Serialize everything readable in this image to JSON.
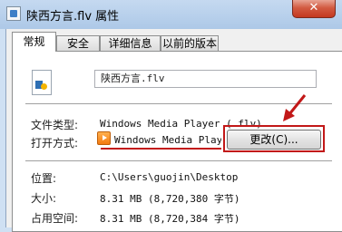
{
  "window": {
    "title": "陕西方言.flv 属性",
    "close_label": "✕"
  },
  "tabs": [
    {
      "label": "常规",
      "active": true
    },
    {
      "label": "安全",
      "active": false
    },
    {
      "label": "详细信息",
      "active": false
    },
    {
      "label": "以前的版本",
      "active": false
    }
  ],
  "general": {
    "filename": "陕西方言.flv",
    "file_type_label": "文件类型:",
    "file_type_value": "Windows Media Player (.flv)",
    "opens_with_label": "打开方式:",
    "opens_with_value": "Windows Media Player",
    "change_button": "更改(C)...",
    "location_label": "位置:",
    "location_value": "C:\\Users\\guojin\\Desktop",
    "size_label": "大小:",
    "size_value": "8.31 MB (8,720,380 字节)",
    "size_on_disk_label": "占用空间:",
    "size_on_disk_value": "8.31 MB (8,720,384 字节)"
  },
  "annotations": {
    "highlight_color": "#c21818",
    "arrow": "red-arrow-pointing-to-change-button"
  },
  "icons": {
    "app": "video-file-icon",
    "file": "flv-file-icon",
    "player": "media-player-icon",
    "close": "close-icon"
  }
}
